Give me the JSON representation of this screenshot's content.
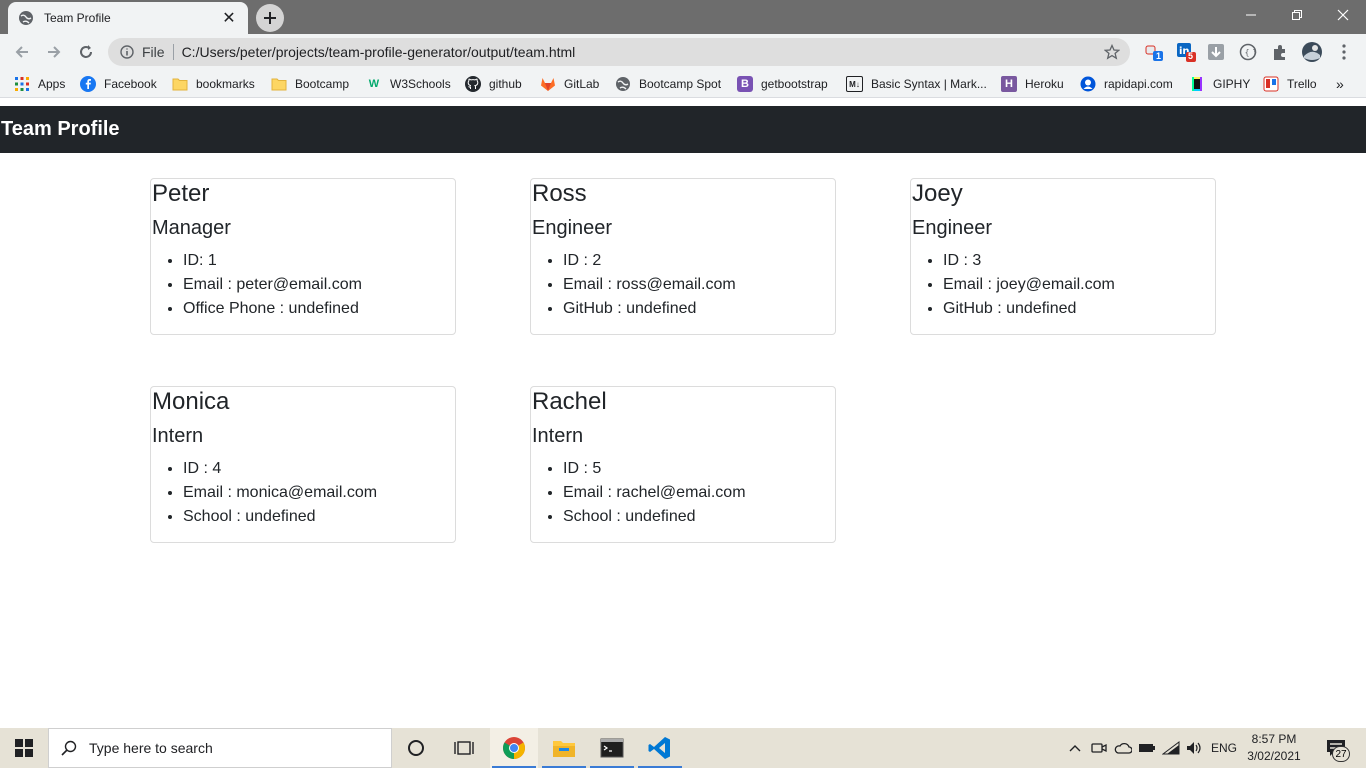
{
  "browser": {
    "tab": {
      "title": "Team Profile",
      "favicon": "globe-icon"
    },
    "omnibox": {
      "scheme_label": "File",
      "url": "C:/Users/peter/projects/team-profile-generator/output/team.html"
    },
    "extensions": {
      "badge_1": "1",
      "badge_5": "5"
    },
    "bookmarks": [
      {
        "label": "Apps",
        "icon": "apps-grid-icon"
      },
      {
        "label": "Facebook",
        "icon": "facebook-icon"
      },
      {
        "label": "bookmarks",
        "icon": "folder-icon"
      },
      {
        "label": "Bootcamp",
        "icon": "folder-icon"
      },
      {
        "label": "W3Schools",
        "icon": "w3schools-icon"
      },
      {
        "label": "github",
        "icon": "github-icon"
      },
      {
        "label": "GitLab",
        "icon": "gitlab-icon"
      },
      {
        "label": "Bootcamp Spot",
        "icon": "globe-icon"
      },
      {
        "label": "getbootstrap",
        "icon": "bootstrap-icon"
      },
      {
        "label": "Basic Syntax | Mark...",
        "icon": "markdown-icon"
      },
      {
        "label": "Heroku",
        "icon": "heroku-icon"
      },
      {
        "label": "rapidapi.com",
        "icon": "rapidapi-icon"
      },
      {
        "label": "GIPHY",
        "icon": "giphy-icon"
      },
      {
        "label": "Trello",
        "icon": "trello-icon"
      }
    ],
    "bookmark_icon_glyphs": {
      "bootstrap": "B",
      "markdown": "M↓",
      "heroku": "H",
      "w3": "W"
    }
  },
  "page": {
    "title": "Team Profile",
    "members": [
      {
        "name": "Peter",
        "role": "Manager",
        "details": [
          "ID: 1",
          "Email : peter@email.com",
          "Office Phone : undefined"
        ]
      },
      {
        "name": "Ross",
        "role": "Engineer",
        "details": [
          "ID : 2",
          "Email : ross@email.com",
          "GitHub : undefined"
        ]
      },
      {
        "name": "Joey",
        "role": "Engineer",
        "details": [
          "ID : 3",
          "Email : joey@email.com",
          "GitHub : undefined"
        ]
      },
      {
        "name": "Monica",
        "role": "Intern",
        "details": [
          "ID : 4",
          "Email : monica@email.com",
          "School : undefined"
        ]
      },
      {
        "name": "Rachel",
        "role": "Intern",
        "details": [
          "ID : 5",
          "Email : rachel@emai.com",
          "School : undefined"
        ]
      }
    ]
  },
  "taskbar": {
    "search_placeholder": "Type here to search",
    "language": "ENG",
    "time": "8:57 PM",
    "date": "3/02/2021",
    "notification_count": "27"
  }
}
